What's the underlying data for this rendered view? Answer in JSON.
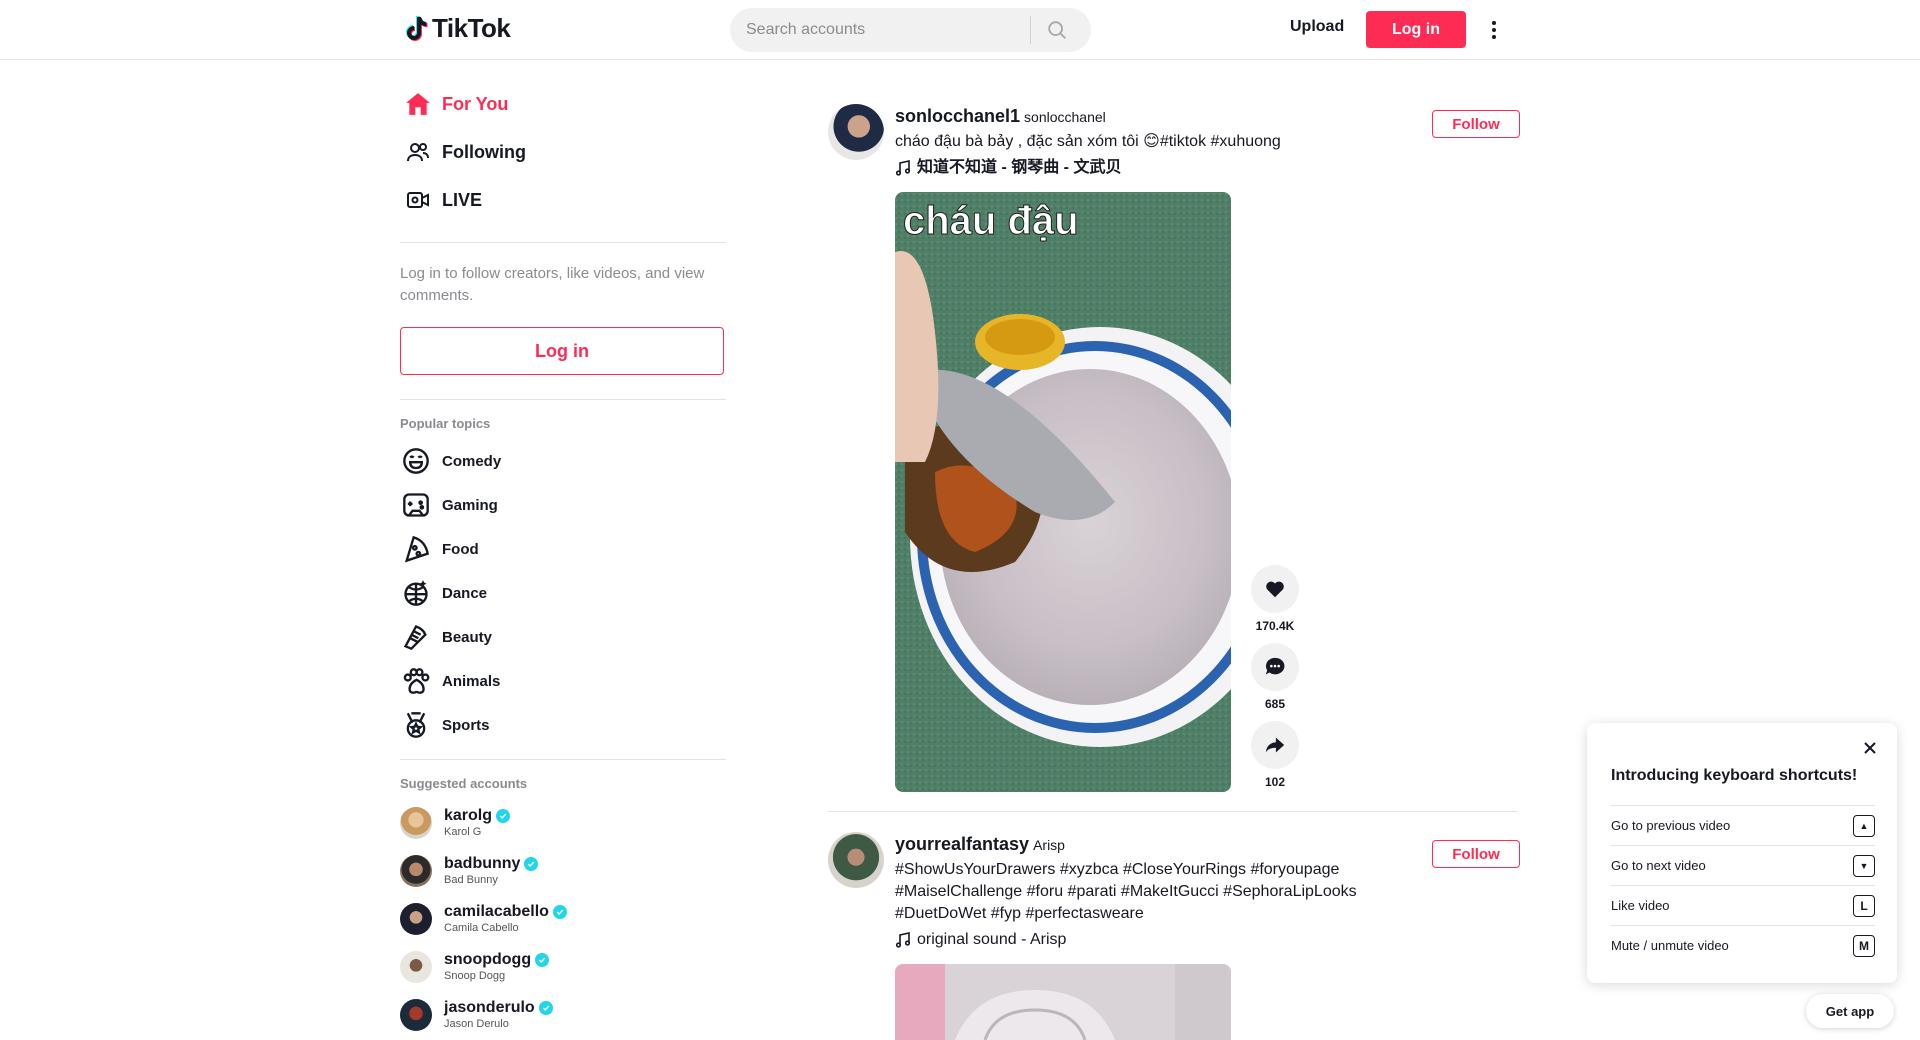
{
  "header": {
    "logo_text": "TikTok",
    "search_placeholder": "Search accounts",
    "upload_label": "Upload",
    "login_label": "Log in"
  },
  "sidebar": {
    "nav": [
      {
        "label": "For You",
        "icon": "home-icon",
        "active": true
      },
      {
        "label": "Following",
        "icon": "following-icon",
        "active": false
      },
      {
        "label": "LIVE",
        "icon": "live-icon",
        "active": false
      }
    ],
    "login_hint": "Log in to follow creators, like videos, and view comments.",
    "login_label": "Log in",
    "popular_title": "Popular topics",
    "topics": [
      {
        "label": "Comedy",
        "icon": "comedy-icon"
      },
      {
        "label": "Gaming",
        "icon": "gaming-icon"
      },
      {
        "label": "Food",
        "icon": "food-icon"
      },
      {
        "label": "Dance",
        "icon": "dance-icon"
      },
      {
        "label": "Beauty",
        "icon": "beauty-icon"
      },
      {
        "label": "Animals",
        "icon": "animals-icon"
      },
      {
        "label": "Sports",
        "icon": "sports-icon"
      }
    ],
    "suggested_title": "Suggested accounts",
    "accounts": [
      {
        "username": "karolg",
        "name": "Karol G"
      },
      {
        "username": "badbunny",
        "name": "Bad Bunny"
      },
      {
        "username": "camilacabello",
        "name": "Camila Cabello"
      },
      {
        "username": "snoopdogg",
        "name": "Snoop Dogg"
      },
      {
        "username": "jasonderulo",
        "name": "Jason Derulo"
      }
    ]
  },
  "feed": [
    {
      "author": "sonlocchanel1",
      "nickname": "sonlocchanel",
      "caption": "cháo đậu bà bảy , đặc sản xóm tôi 😊#tiktok #xuhuong",
      "music": "知道不知道 - 钢琴曲 - 文武贝",
      "follow_label": "Follow",
      "video_overlay_text": "cháu đậu",
      "likes": "170.4K",
      "comments": "685",
      "shares": "102"
    },
    {
      "author": "yourrealfantasy",
      "nickname": "Arisp",
      "caption_lines": [
        "#ShowUsYourDrawers #xyzbca #CloseYourRings #foryoupage",
        "#MaiselChallenge #foru #parati #MakeItGucci #SephoraLipLooks",
        "#DuetDoWet #fyp #perfectasweare"
      ],
      "music": "original sound - Arisp",
      "follow_label": "Follow"
    }
  ],
  "keyboard_panel": {
    "title": "Introducing keyboard shortcuts!",
    "rows": [
      {
        "label": "Go to previous video",
        "key": "▲"
      },
      {
        "label": "Go to next video",
        "key": "▼"
      },
      {
        "label": "Like video",
        "key": "L"
      },
      {
        "label": "Mute / unmute video",
        "key": "M"
      }
    ]
  },
  "get_app_label": "Get app",
  "colors": {
    "accent": "#fe2c55",
    "verified": "#20d5ec",
    "text": "#161823",
    "muted": "#8a8b91"
  }
}
